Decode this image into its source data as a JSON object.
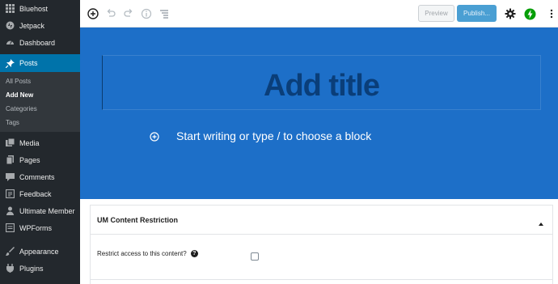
{
  "sidebar": {
    "top_items": [
      {
        "label": "Bluehost",
        "icon": "bluehost-icon"
      },
      {
        "label": "Jetpack",
        "icon": "jetpack-icon"
      },
      {
        "label": "Dashboard",
        "icon": "dashboard-icon"
      }
    ],
    "active_item": {
      "label": "Posts",
      "icon": "pushpin-icon"
    },
    "submenu": [
      {
        "label": "All Posts"
      },
      {
        "label": "Add New"
      },
      {
        "label": "Categories"
      },
      {
        "label": "Tags"
      }
    ],
    "bottom_items": [
      {
        "label": "Media",
        "icon": "media-icon"
      },
      {
        "label": "Pages",
        "icon": "pages-icon"
      },
      {
        "label": "Comments",
        "icon": "comments-icon"
      },
      {
        "label": "Feedback",
        "icon": "feedback-icon"
      },
      {
        "label": "Ultimate Member",
        "icon": "user-icon"
      },
      {
        "label": "WPForms",
        "icon": "wpforms-icon"
      },
      {
        "label": "Appearance",
        "icon": "appearance-icon"
      },
      {
        "label": "Plugins",
        "icon": "plugins-icon"
      }
    ]
  },
  "toolbar": {
    "preview_label": "Preview",
    "publish_label": "Publish..."
  },
  "editor": {
    "title_placeholder": "Add title",
    "body_placeholder": "Start writing or type / to choose a block"
  },
  "meta_box": {
    "title": "UM Content Restriction",
    "restrict_label": "Restrict access to this content?",
    "help_glyph": "?"
  },
  "colors": {
    "sidebar_bg": "#23282d",
    "active_menu": "#0073aa",
    "canvas_bg": "#1d6fc8",
    "publish_btn": "#4a9fd3",
    "jetpack_green": "#069e08"
  }
}
